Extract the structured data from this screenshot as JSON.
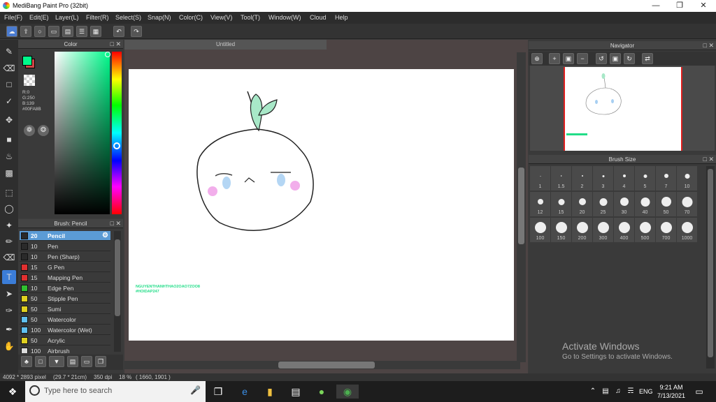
{
  "window": {
    "title": "MediBang Paint Pro (32bit)"
  },
  "menu": [
    "File(F)",
    "Edit(E)",
    "Layer(L)",
    "Filter(R)",
    "Select(S)",
    "Snap(N)",
    "Color(C)",
    "View(V)",
    "Tool(T)",
    "Window(W)",
    "Cloud",
    "Help"
  ],
  "color_panel": {
    "title": "Color",
    "r": "R:0",
    "g": "G:250",
    "b": "B:139",
    "hex": "#00FA8B",
    "fg": "#00FA8B",
    "bg": "#D04848"
  },
  "brush_panel": {
    "title": "Brush: Pencil",
    "items": [
      {
        "size": "20",
        "name": "Pencil",
        "color": "#2a2a2a"
      },
      {
        "size": "10",
        "name": "Pen",
        "color": "#2a2a2a"
      },
      {
        "size": "10",
        "name": "Pen (Sharp)",
        "color": "#2a2a2a"
      },
      {
        "size": "15",
        "name": "G Pen",
        "color": "#e03030"
      },
      {
        "size": "15",
        "name": "Mapping Pen",
        "color": "#e03030"
      },
      {
        "size": "10",
        "name": "Edge Pen",
        "color": "#30c030"
      },
      {
        "size": "50",
        "name": "Stipple Pen",
        "color": "#e0d020"
      },
      {
        "size": "50",
        "name": "Sumi",
        "color": "#e0d020"
      },
      {
        "size": "50",
        "name": "Watercolor",
        "color": "#60c0f0"
      },
      {
        "size": "100",
        "name": "Watercolor (Wet)",
        "color": "#60c0f0"
      },
      {
        "size": "50",
        "name": "Acrylic",
        "color": "#e0d020"
      },
      {
        "size": "100",
        "name": "Airbrush",
        "color": "#dddddd"
      }
    ]
  },
  "document": {
    "tab": "Untitled",
    "signature": "NGUYENTHANHTHAO2OAO7ZOO8",
    "signature2": "#HOIDAP247"
  },
  "navigator": {
    "title": "Navigator"
  },
  "brush_size": {
    "title": "Brush Size",
    "sizes": [
      "1",
      "1.5",
      "2",
      "3",
      "4",
      "5",
      "7",
      "10",
      "12",
      "15",
      "20",
      "25",
      "30",
      "40",
      "50",
      "70",
      "100",
      "150",
      "200",
      "300",
      "400",
      "500",
      "700",
      "1000"
    ]
  },
  "watermark": {
    "line1": "Activate Windows",
    "line2": "Go to Settings to activate Windows."
  },
  "status": {
    "size": "4092 * 2893 pixel",
    "physical": "(29.7 * 21cm)",
    "dpi": "350 dpi",
    "zoom": "18 %",
    "coords": "( 1660, 1901 )"
  },
  "taskbar": {
    "search_placeholder": "Type here to search",
    "time": "9:21 AM",
    "date": "7/13/2021",
    "lang": "ENG"
  }
}
